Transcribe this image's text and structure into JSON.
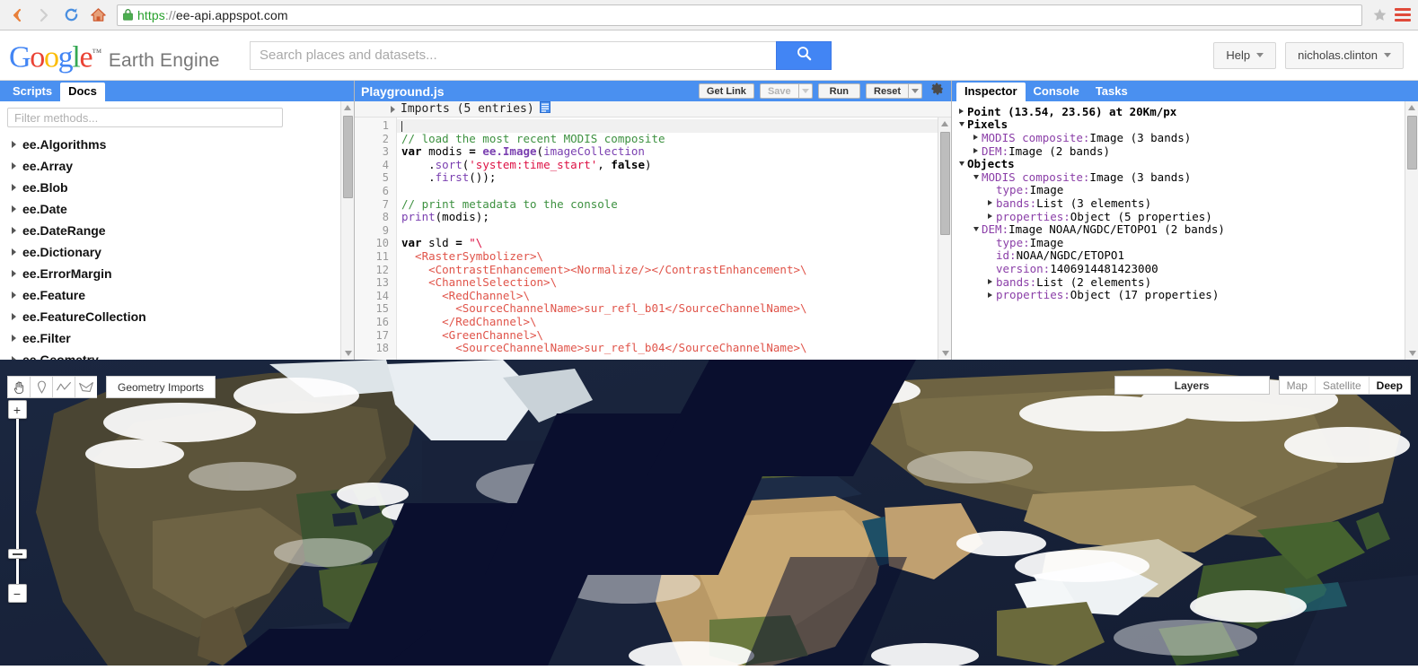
{
  "browser": {
    "back_icon": "back-arrow-icon",
    "forward_icon": "forward-arrow-icon",
    "reload_icon": "reload-icon",
    "home_icon": "home-icon",
    "lock_icon": "lock-icon",
    "url_scheme": "https",
    "url_sep": "://",
    "url_host": "ee-api.appspot.com",
    "star_icon": "star-icon",
    "menu_icon": "hamburger-menu-icon"
  },
  "header": {
    "logo": {
      "g1": "G",
      "o1": "o",
      "o2": "o",
      "g2": "g",
      "l": "l",
      "e": "e",
      "tm": "™"
    },
    "product": "Earth Engine",
    "search_placeholder": "Search places and datasets...",
    "search_value": "",
    "search_icon": "search-icon",
    "help_label": "Help",
    "account_label": "nicholas.clinton"
  },
  "docs": {
    "tabs": [
      {
        "label": "Scripts",
        "active": false
      },
      {
        "label": "Docs",
        "active": true
      }
    ],
    "filter_placeholder": "Filter methods...",
    "filter_value": "",
    "items": [
      {
        "label": "ee.Algorithms"
      },
      {
        "label": "ee.Array"
      },
      {
        "label": "ee.Blob"
      },
      {
        "label": "ee.Date"
      },
      {
        "label": "ee.DateRange"
      },
      {
        "label": "ee.Dictionary"
      },
      {
        "label": "ee.ErrorMargin"
      },
      {
        "label": "ee.Feature"
      },
      {
        "label": "ee.FeatureCollection"
      },
      {
        "label": "ee.Filter"
      },
      {
        "label": "ee.Geometry"
      }
    ]
  },
  "editor": {
    "title": "Playground.js",
    "get_link_label": "Get Link",
    "save_label": "Save",
    "run_label": "Run",
    "reset_label": "Reset",
    "settings_icon": "gear-icon",
    "imports_label": "Imports (5 entries)",
    "imports_icon": "list-icon",
    "line_numbers": [
      1,
      2,
      3,
      4,
      5,
      6,
      7,
      8,
      9,
      10,
      11,
      12,
      13,
      14,
      15,
      16,
      17,
      18
    ],
    "lines": [
      {
        "n": 1,
        "text": ""
      },
      {
        "n": 2,
        "text": "// load the most recent MODIS composite"
      },
      {
        "n": 3,
        "text": "var modis = ee.Image(imageCollection"
      },
      {
        "n": 4,
        "text": "    .sort('system:time_start', false)"
      },
      {
        "n": 5,
        "text": "    .first());"
      },
      {
        "n": 6,
        "text": ""
      },
      {
        "n": 7,
        "text": "// print metadata to the console"
      },
      {
        "n": 8,
        "text": "print(modis);"
      },
      {
        "n": 9,
        "text": ""
      },
      {
        "n": 10,
        "text": "var sld = \"\\"
      },
      {
        "n": 11,
        "text": "  <RasterSymbolizer>\\"
      },
      {
        "n": 12,
        "text": "    <ContrastEnhancement><Normalize/></ContrastEnhancement>\\"
      },
      {
        "n": 13,
        "text": "    <ChannelSelection>\\"
      },
      {
        "n": 14,
        "text": "      <RedChannel>\\"
      },
      {
        "n": 15,
        "text": "        <SourceChannelName>sur_refl_b01</SourceChannelName>\\"
      },
      {
        "n": 16,
        "text": "      </RedChannel>\\"
      },
      {
        "n": 17,
        "text": "      <GreenChannel>\\"
      },
      {
        "n": 18,
        "text": "        <SourceChannelName>sur_refl_b04</SourceChannelName>\\"
      }
    ]
  },
  "inspector": {
    "tabs": [
      {
        "label": "Inspector",
        "active": true
      },
      {
        "label": "Console",
        "active": false
      },
      {
        "label": "Tasks",
        "active": false
      }
    ],
    "rows": [
      {
        "indent": 0,
        "toggle": "right",
        "key": "Point (13.54, 23.56) at 20Km/px",
        "key_style": "bold",
        "val": ""
      },
      {
        "indent": 0,
        "toggle": "down",
        "key": "Pixels",
        "key_style": "bold",
        "val": ""
      },
      {
        "indent": 1,
        "toggle": "right",
        "key": "MODIS composite:",
        "key_style": "purple",
        "val": " Image (3 bands)"
      },
      {
        "indent": 1,
        "toggle": "right",
        "key": "DEM:",
        "key_style": "purple",
        "val": " Image (2 bands)"
      },
      {
        "indent": 0,
        "toggle": "down",
        "key": "Objects",
        "key_style": "bold",
        "val": ""
      },
      {
        "indent": 1,
        "toggle": "down",
        "key": "MODIS composite:",
        "key_style": "purple",
        "val": " Image (3 bands)"
      },
      {
        "indent": 2,
        "toggle": "none",
        "key": "type:",
        "key_style": "purple",
        "val": " Image"
      },
      {
        "indent": 2,
        "toggle": "right",
        "key": "bands:",
        "key_style": "purple",
        "val": " List (3 elements)"
      },
      {
        "indent": 2,
        "toggle": "right",
        "key": "properties:",
        "key_style": "purple",
        "val": " Object (5 properties)"
      },
      {
        "indent": 1,
        "toggle": "down",
        "key": "DEM:",
        "key_style": "purple",
        "val": " Image NOAA/NGDC/ETOPO1 (2 bands)"
      },
      {
        "indent": 2,
        "toggle": "none",
        "key": "type:",
        "key_style": "purple",
        "val": " Image"
      },
      {
        "indent": 2,
        "toggle": "none",
        "key": "id:",
        "key_style": "purple",
        "val": " NOAA/NGDC/ETOPO1"
      },
      {
        "indent": 2,
        "toggle": "none",
        "key": "version:",
        "key_style": "purple",
        "val": " 1406914481423000"
      },
      {
        "indent": 2,
        "toggle": "right",
        "key": "bands:",
        "key_style": "purple",
        "val": " List (2 elements)"
      },
      {
        "indent": 2,
        "toggle": "right",
        "key": "properties:",
        "key_style": "purple",
        "val": " Object (17 properties)"
      }
    ]
  },
  "map": {
    "tools": [
      {
        "icon": "hand-pan-icon",
        "active": true
      },
      {
        "icon": "marker-point-icon",
        "active": false
      },
      {
        "icon": "line-icon",
        "active": false
      },
      {
        "icon": "polygon-icon",
        "active": false
      }
    ],
    "geometry_imports_label": "Geometry Imports",
    "zoom_in_label": "+",
    "zoom_out_label": "−",
    "layers_label": "Layers",
    "basemaps": [
      {
        "label": "Map",
        "active": false
      },
      {
        "label": "Satellite",
        "active": false
      },
      {
        "label": "Deep",
        "active": true
      }
    ]
  },
  "colors": {
    "accent_blue": "#4a90f0",
    "google_blue": "#4285f4",
    "google_red": "#ea4335",
    "google_yellow": "#fbbc05",
    "google_green": "#34a853",
    "comment_green": "#3d9140",
    "string_red": "#d14",
    "namespace_purple": "#7a3fb0",
    "xml_red": "#e0544a",
    "nodata_navy": "#0a0f2e"
  }
}
